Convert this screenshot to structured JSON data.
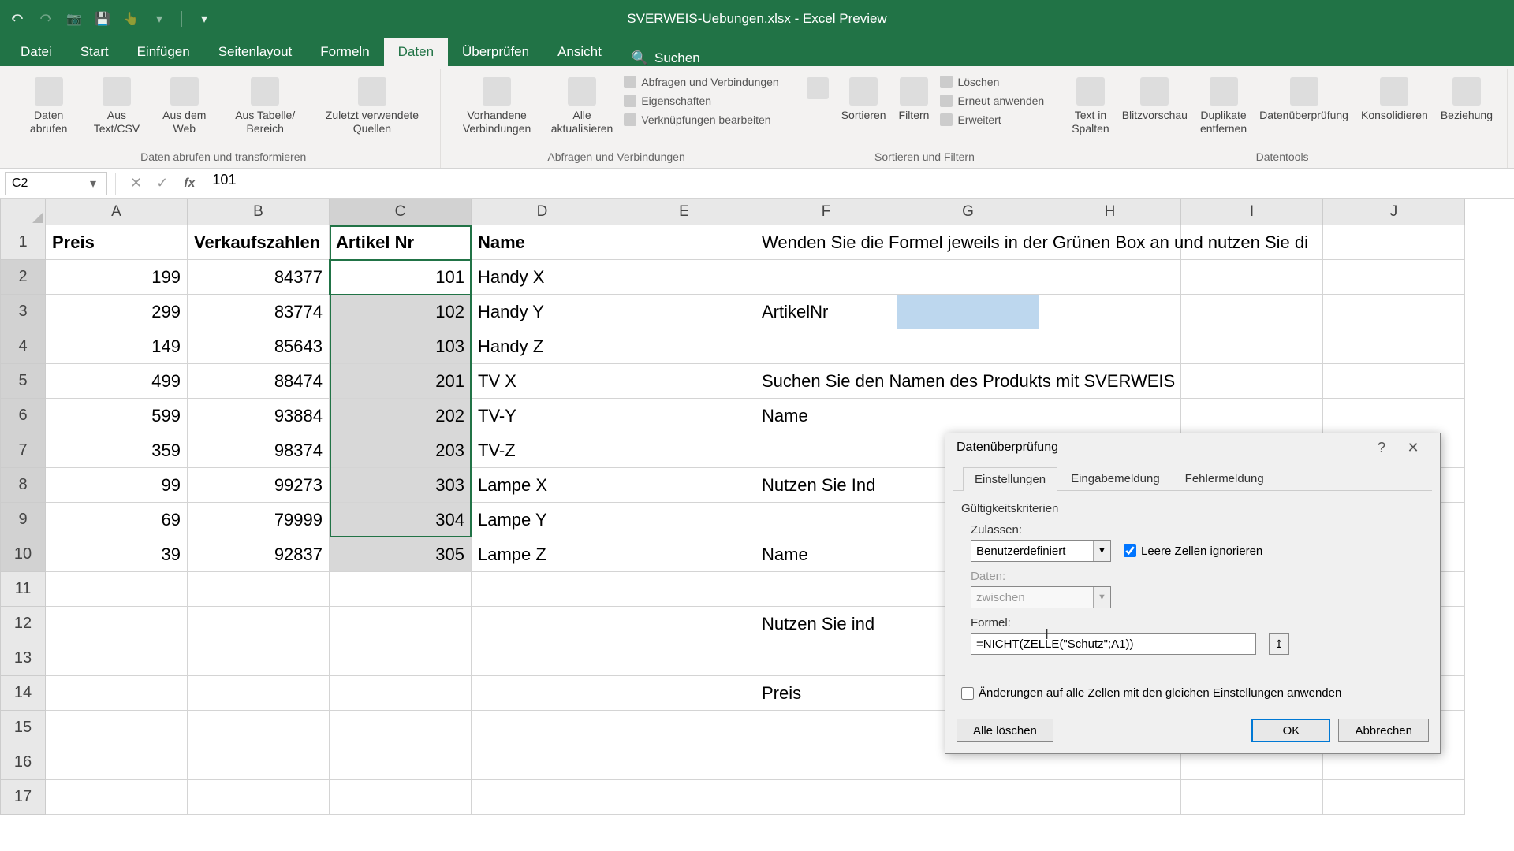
{
  "app": {
    "title": "SVERWEIS-Uebungen.xlsx - Excel Preview"
  },
  "ribbon": {
    "tabs": [
      "Datei",
      "Start",
      "Einfügen",
      "Seitenlayout",
      "Formeln",
      "Daten",
      "Überprüfen",
      "Ansicht"
    ],
    "active_tab": "Daten",
    "search_placeholder": "Suchen",
    "groups": {
      "g1": {
        "label": "Daten abrufen und transformieren",
        "items": [
          "Daten abrufen",
          "Aus Text/CSV",
          "Aus dem Web",
          "Aus Tabelle/ Bereich",
          "Zuletzt verwendete Quellen"
        ]
      },
      "g2": {
        "label": "Abfragen und Verbindungen",
        "items_lg": [
          "Vorhandene Verbindungen",
          "Alle aktualisieren"
        ],
        "items_sm": [
          "Abfragen und Verbindungen",
          "Eigenschaften",
          "Verknüpfungen bearbeiten"
        ]
      },
      "g3": {
        "label": "Sortieren und Filtern",
        "items_lg": [
          "Sortieren",
          "Filtern"
        ],
        "items_sm": [
          "Löschen",
          "Erneut anwenden",
          "Erweitert"
        ]
      },
      "g4": {
        "label": "Datentools",
        "items": [
          "Text in Spalten",
          "Blitzvorschau",
          "Duplikate entfernen",
          "Datenüberprüfung",
          "Konsolidieren",
          "Beziehung"
        ]
      }
    }
  },
  "formula_bar": {
    "name_box": "C2",
    "formula": "101"
  },
  "grid": {
    "columns": [
      "A",
      "B",
      "C",
      "D",
      "E",
      "F",
      "G",
      "H",
      "I",
      "J"
    ],
    "rows": [
      {
        "n": 1,
        "A": "Preis",
        "B": "Verkaufszahlen",
        "C": "Artikel Nr",
        "D": "Name",
        "E": "",
        "F": "Wenden Sie die Formel jeweils in der Grünen Box an und nutzen Sie di"
      },
      {
        "n": 2,
        "A": "199",
        "B": "84377",
        "C": "101",
        "D": "Handy X",
        "E": "",
        "F": ""
      },
      {
        "n": 3,
        "A": "299",
        "B": "83774",
        "C": "102",
        "D": "Handy Y",
        "E": "",
        "F": "ArtikelNr",
        "G_green": true
      },
      {
        "n": 4,
        "A": "149",
        "B": "85643",
        "C": "103",
        "D": "Handy Z",
        "E": "",
        "F": ""
      },
      {
        "n": 5,
        "A": "499",
        "B": "88474",
        "C": "201",
        "D": "TV X",
        "E": "",
        "F": "Suchen Sie den Namen des Produkts mit SVERWEIS"
      },
      {
        "n": 6,
        "A": "599",
        "B": "93884",
        "C": "202",
        "D": "TV-Y",
        "E": "",
        "F": "Name"
      },
      {
        "n": 7,
        "A": "359",
        "B": "98374",
        "C": "203",
        "D": "TV-Z",
        "E": "",
        "F": ""
      },
      {
        "n": 8,
        "A": "99",
        "B": "99273",
        "C": "303",
        "D": "Lampe X",
        "E": "",
        "F": "Nutzen Sie Ind"
      },
      {
        "n": 9,
        "A": "69",
        "B": "79999",
        "C": "304",
        "D": "Lampe Y",
        "E": "",
        "F": ""
      },
      {
        "n": 10,
        "A": "39",
        "B": "92837",
        "C": "305",
        "D": "Lampe Z",
        "E": "",
        "F": "Name"
      },
      {
        "n": 11,
        "A": "",
        "B": "",
        "C": "",
        "D": "",
        "E": "",
        "F": ""
      },
      {
        "n": 12,
        "A": "",
        "B": "",
        "C": "",
        "D": "",
        "E": "",
        "F": "Nutzen Sie ind"
      },
      {
        "n": 13,
        "A": "",
        "B": "",
        "C": "",
        "D": "",
        "E": "",
        "F": ""
      },
      {
        "n": 14,
        "A": "",
        "B": "",
        "C": "",
        "D": "",
        "E": "",
        "F": "Preis"
      },
      {
        "n": 15,
        "A": "",
        "B": "",
        "C": "",
        "D": "",
        "E": "",
        "F": ""
      },
      {
        "n": 16,
        "A": "",
        "B": "",
        "C": "",
        "D": "",
        "E": "",
        "F": ""
      },
      {
        "n": 17,
        "A": "",
        "B": "",
        "C": "",
        "D": "",
        "E": "",
        "F": ""
      }
    ],
    "selected_col": "C",
    "active_cell": "C2",
    "selection_range": "C2:C10"
  },
  "dialog": {
    "title": "Datenüberprüfung",
    "tabs": [
      "Einstellungen",
      "Eingabemeldung",
      "Fehlermeldung"
    ],
    "active_tab": "Einstellungen",
    "criteria_label": "Gültigkeitskriterien",
    "allow_label": "Zulassen:",
    "allow_value": "Benutzerdefiniert",
    "ignore_blank_label": "Leere Zellen ignorieren",
    "ignore_blank_checked": true,
    "data_label": "Daten:",
    "data_value": "zwischen",
    "formula_label": "Formel:",
    "formula_value": "=NICHT(ZELLE(\"Schutz\";A1))",
    "apply_all_label": "Änderungen auf alle Zellen mit den gleichen Einstellungen anwenden",
    "apply_all_checked": false,
    "btn_clear": "Alle löschen",
    "btn_ok": "OK",
    "btn_cancel": "Abbrechen"
  }
}
